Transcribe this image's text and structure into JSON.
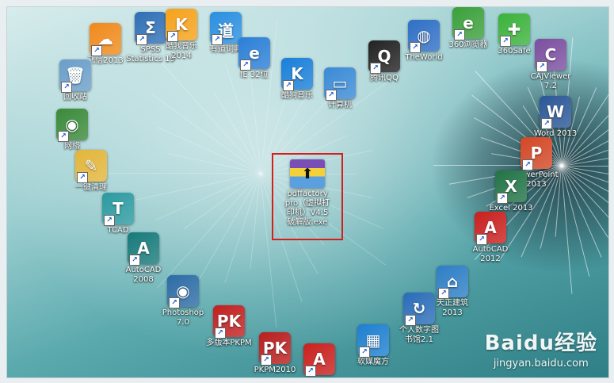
{
  "desktop": {
    "icons": [
      {
        "id": "feixin",
        "label": "飞信2013",
        "icon": "feixin-icon",
        "color": "#f08a1c"
      },
      {
        "id": "spss",
        "label": "SPSS\nStatistics 19",
        "icon": "spss-icon",
        "color": "#2f6fb5"
      },
      {
        "id": "kuwo",
        "label": "酷我音乐\n2014",
        "icon": "kuwo-music-icon",
        "color": "#f5a21a"
      },
      {
        "id": "youdao",
        "label": "有道词典",
        "icon": "youdao-dict-icon",
        "color": "#2a8fe0"
      },
      {
        "id": "ie",
        "label": "IE 32位",
        "icon": "internet-explorer-icon",
        "color": "#2b7fd6"
      },
      {
        "id": "kugou",
        "label": "酷狗音乐",
        "icon": "kugou-music-icon",
        "color": "#1a7fd9"
      },
      {
        "id": "computer",
        "label": "计算机",
        "icon": "computer-icon",
        "color": "#3a8ad6"
      },
      {
        "id": "qq",
        "label": "腾讯QQ",
        "icon": "qq-penguin-icon",
        "color": "#222222"
      },
      {
        "id": "theworld",
        "label": "TheWorld",
        "icon": "theworld-browser-icon",
        "color": "#2f6fc5"
      },
      {
        "id": "360browser",
        "label": "360浏览器",
        "icon": "360-browser-icon",
        "color": "#3aa03a"
      },
      {
        "id": "360safe",
        "label": "360Safe",
        "icon": "360-safe-icon",
        "color": "#3bb23b"
      },
      {
        "id": "cajviewer",
        "label": "CAJViewer\n7.2",
        "icon": "cajviewer-icon",
        "color": "#7b4fa0"
      },
      {
        "id": "word",
        "label": "Word 2013",
        "icon": "word-icon",
        "color": "#2b5797"
      },
      {
        "id": "powerpoint",
        "label": "PowerPoint\n2013",
        "icon": "powerpoint-icon",
        "color": "#d24726"
      },
      {
        "id": "excel",
        "label": "Excel 2013",
        "icon": "excel-icon",
        "color": "#217346"
      },
      {
        "id": "autocad2012",
        "label": "AutoCAD\n2012",
        "icon": "autocad-icon",
        "color": "#c8201e"
      },
      {
        "id": "tianzheng",
        "label": "天正建筑\n2013",
        "icon": "tianzheng-icon",
        "color": "#2d7ec5"
      },
      {
        "id": "gerenshuzi",
        "label": "个人数字图\n书馆2.1",
        "icon": "digital-library-icon",
        "color": "#2a6cb8"
      },
      {
        "id": "recyclebin",
        "label": "回收站",
        "icon": "recycle-bin-icon",
        "color": "#6a9ec9"
      },
      {
        "id": "network",
        "label": "网络",
        "icon": "network-icon",
        "color": "#3a8a3a"
      },
      {
        "id": "cleanup",
        "label": "一键清理",
        "icon": "broom-icon",
        "color": "#e2b53a"
      },
      {
        "id": "tcad",
        "label": "TCAD",
        "icon": "tcad-icon",
        "color": "#2b9aa0"
      },
      {
        "id": "autocad2008",
        "label": "AutoCAD\n2008",
        "icon": "autocad-icon",
        "color": "#177a7a"
      },
      {
        "id": "photoshop",
        "label": "Photoshop\n7.0",
        "icon": "photoshop-icon",
        "color": "#2c6ca6"
      },
      {
        "id": "pkpm",
        "label": "多版本PKPM",
        "icon": "pkpm-icon",
        "color": "#c02020"
      },
      {
        "id": "pkpm2010",
        "label": "PKPM2010",
        "icon": "pkpm-2010-icon",
        "color": "#b81e1e"
      },
      {
        "id": "autocadbottom",
        "label": "",
        "icon": "autocad-icon",
        "color": "#c8201e"
      },
      {
        "id": "mofang",
        "label": "软媒魔方",
        "icon": "cube-icon",
        "color": "#1e7fd0"
      }
    ],
    "selected_file": {
      "label": "pdffactory\npro（虚拟打\n印机）V4.5\n破解版.exe",
      "icon": "installer-box-icon"
    }
  },
  "watermark": {
    "brand": "Baidu经验",
    "url": "jingyan.baidu.com"
  }
}
